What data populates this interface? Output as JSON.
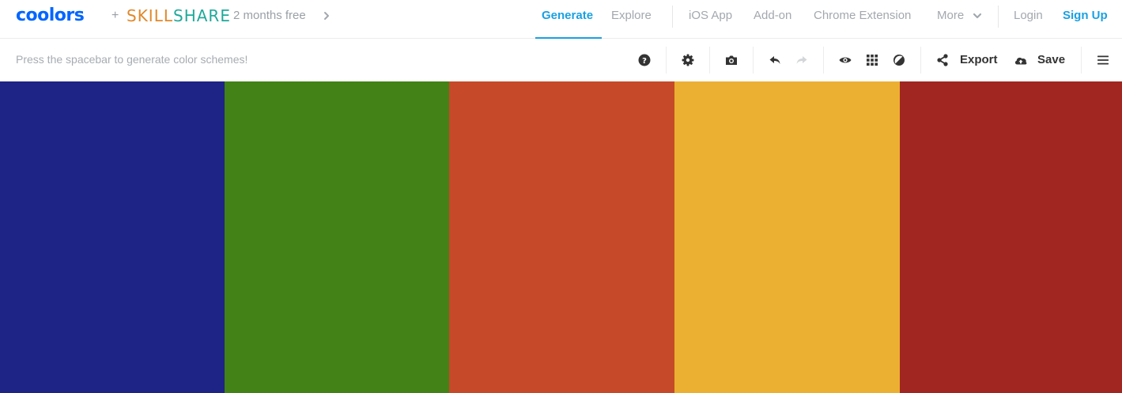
{
  "header": {
    "logo_text": "coolors",
    "plus": "+",
    "partner_part1": "SKILL",
    "partner_part2": "SHARE",
    "promo": "2 months free",
    "nav": {
      "generate": "Generate",
      "explore": "Explore",
      "ios_app": "iOS App",
      "addon": "Add-on",
      "chrome_extension": "Chrome Extension",
      "more": "More",
      "login": "Login",
      "signup": "Sign Up"
    }
  },
  "toolbar": {
    "hint": "Press the spacebar to generate color schemes!",
    "export_label": "Export",
    "save_label": "Save",
    "icons": [
      "help-icon",
      "settings-icon",
      "camera-icon",
      "undo-icon",
      "redo-icon",
      "eye-icon",
      "grid-icon",
      "contrast-icon",
      "share-icon",
      "cloud-upload-icon",
      "menu-icon"
    ]
  },
  "palette": {
    "colors": [
      "#1e2386",
      "#428216",
      "#c64a29",
      "#ebb032",
      "#a12622"
    ]
  },
  "theme": {
    "accent": "#1aa0e2",
    "logo": "#0066ff",
    "partner_orange": "#e0882a",
    "partner_teal": "#20a99a"
  }
}
